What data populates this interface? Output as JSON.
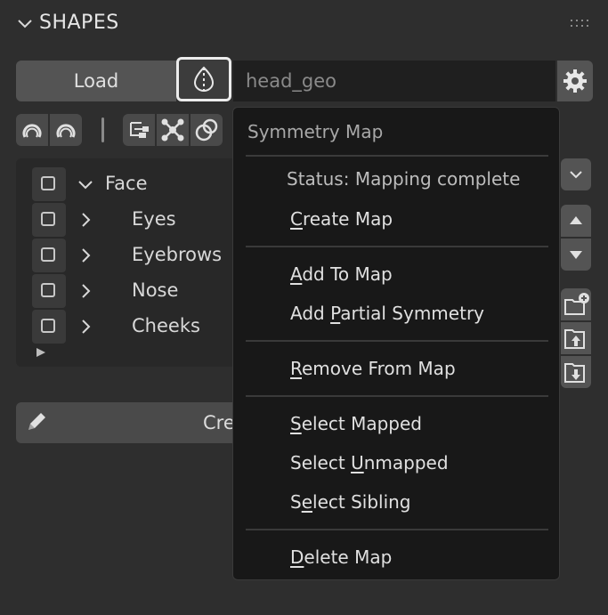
{
  "panel": {
    "title": "SHAPES"
  },
  "toolbar": {
    "load_label": "Load",
    "symmetry_button_icon": "symmetry-icon",
    "name_value": "head_geo",
    "settings_icon": "gear-icon",
    "tools": [
      "mirror-left-icon",
      "mirror-right-icon",
      "hierarchy-icon",
      "node-graph-icon",
      "intersect-icon"
    ]
  },
  "list": {
    "items": [
      {
        "label": "Face",
        "expanded": true,
        "indent": 0
      },
      {
        "label": "Eyes",
        "expanded": false,
        "indent": 1
      },
      {
        "label": "Eyebrows",
        "expanded": false,
        "indent": 1
      },
      {
        "label": "Nose",
        "expanded": false,
        "indent": 1
      },
      {
        "label": "Cheeks",
        "expanded": false,
        "indent": 1
      }
    ]
  },
  "create": {
    "label_visible": "Cre"
  },
  "side_buttons": [
    "chevron-down-icon",
    "arrow-up-icon",
    "arrow-down-icon",
    "new-folder-icon",
    "folder-up-icon",
    "folder-down-icon"
  ],
  "menu": {
    "title": "Symmetry Map",
    "status": "Status: Mapping complete",
    "items": {
      "create_map": {
        "pre": "",
        "key": "C",
        "post": "reate Map"
      },
      "add_to_map": {
        "pre": "",
        "key": "A",
        "post": "dd To Map"
      },
      "add_partial": {
        "pre": "Add ",
        "key": "P",
        "post": "artial Symmetry"
      },
      "remove_from_map": {
        "pre": "",
        "key": "R",
        "post": "emove From Map"
      },
      "select_mapped": {
        "pre": "",
        "key": "S",
        "post": "elect Mapped"
      },
      "select_unmapped": {
        "pre": "Select ",
        "key": "U",
        "post": "nmapped"
      },
      "select_sibling": {
        "pre": "S",
        "key": "e",
        "post": "lect Sibling"
      },
      "delete_map": {
        "pre": "",
        "key": "D",
        "post": "elete Map"
      }
    }
  },
  "colors": {
    "background": "#2e2e2e",
    "button": "#545454",
    "menu_background": "#181818",
    "text": "#e0e0e0"
  }
}
